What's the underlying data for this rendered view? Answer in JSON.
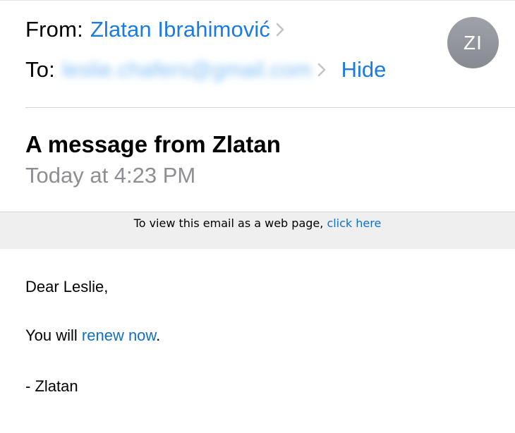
{
  "header": {
    "from_label": "From:",
    "sender_name": "Zlatan Ibrahimović",
    "to_label": "To:",
    "recipient_email": "leslie.chafers@gmail.com",
    "hide_label": "Hide",
    "avatar_initials": "ZI",
    "icons": {
      "sender_chevron": "chevron-right-icon",
      "recipient_chevron": "chevron-right-icon"
    }
  },
  "message": {
    "subject": "A message from Zlatan",
    "date": "Today at 4:23 PM"
  },
  "banner": {
    "text": "To view this email as a web page, ",
    "link_text": "click here"
  },
  "body": {
    "greeting": "Dear Leslie,",
    "line_prefix": "You will ",
    "link_text": "renew now",
    "line_suffix": ".",
    "signature": "- Zlatan"
  },
  "colors": {
    "accent_blue": "#1a7be0",
    "link_blue": "#1270c2",
    "muted_gray": "#8e8e93",
    "avatar_gray": "#8f9298",
    "banner_bg": "#efefef"
  }
}
